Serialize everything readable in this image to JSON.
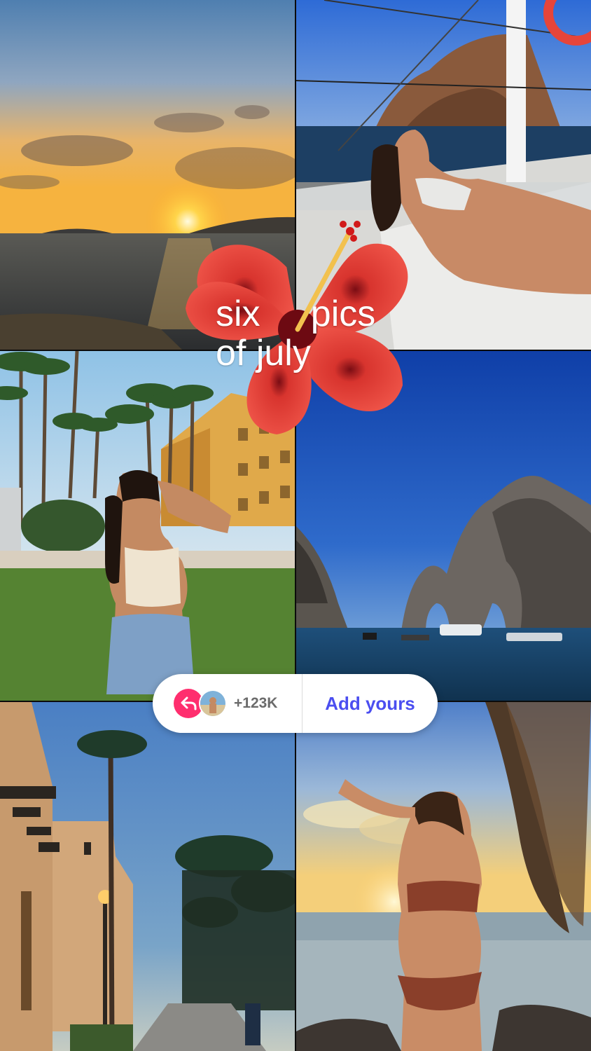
{
  "story": {
    "title_line1": "six     pics",
    "title_line2": "of july",
    "accent_color": "#ff2e6e",
    "link_color": "#4b4ef0"
  },
  "sticker": {
    "icon": "reply-arrow-icon",
    "participants": "+123K",
    "cta_label": "Add yours"
  },
  "photos": [
    {
      "name": "sunset-ocean-photo"
    },
    {
      "name": "catamaran-photo"
    },
    {
      "name": "palm-resort-photo"
    },
    {
      "name": "rock-arch-photo"
    },
    {
      "name": "evening-street-photo"
    },
    {
      "name": "beach-sunset-photo"
    }
  ]
}
